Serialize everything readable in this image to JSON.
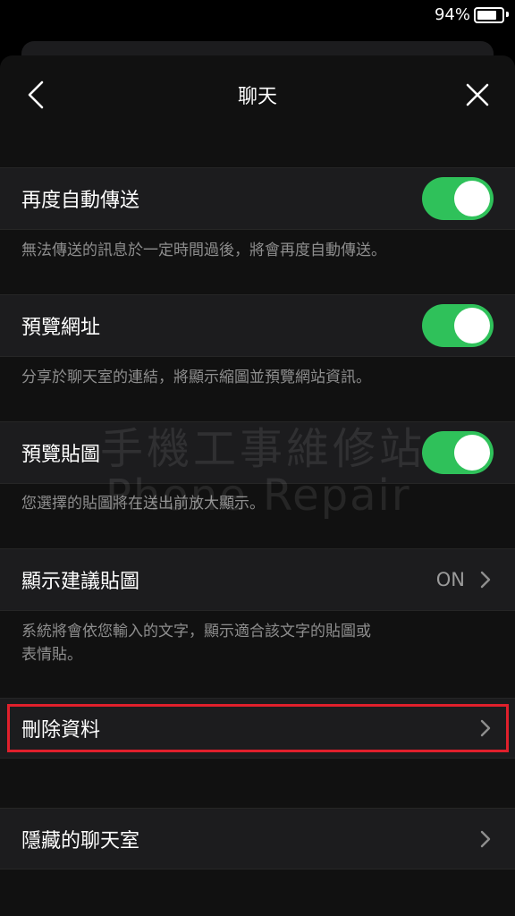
{
  "status_bar": {
    "battery_percent": "94%",
    "battery_level": 0.94
  },
  "nav": {
    "title": "聊天",
    "back_icon": "chevron-left-icon",
    "close_icon": "close-icon"
  },
  "settings": [
    {
      "label": "再度自動傳送",
      "toggle": true,
      "description": "無法傳送的訊息於一定時間過後，將會再度自動傳送。"
    },
    {
      "label": "預覽網址",
      "toggle": true,
      "description": "分享於聊天室的連結，將顯示縮圖並預覽網站資訊。"
    },
    {
      "label": "預覽貼圖",
      "toggle": true,
      "description": "您選擇的貼圖將在送出前放大顯示。"
    },
    {
      "label": "顯示建議貼圖",
      "value": "ON",
      "description_line1": "系統將會依您輸入的文字，顯示適合該文字的貼圖或",
      "description_line2": "表情貼。"
    },
    {
      "label": "刪除資料"
    },
    {
      "label": "隱藏的聊天室"
    }
  ],
  "watermark": {
    "line1": "手機工事維修站",
    "line2": "Phone Repair"
  },
  "colors": {
    "toggle_on": "#2fc15a",
    "highlight": "#e0202c",
    "row_bg": "#1c1c1e"
  }
}
